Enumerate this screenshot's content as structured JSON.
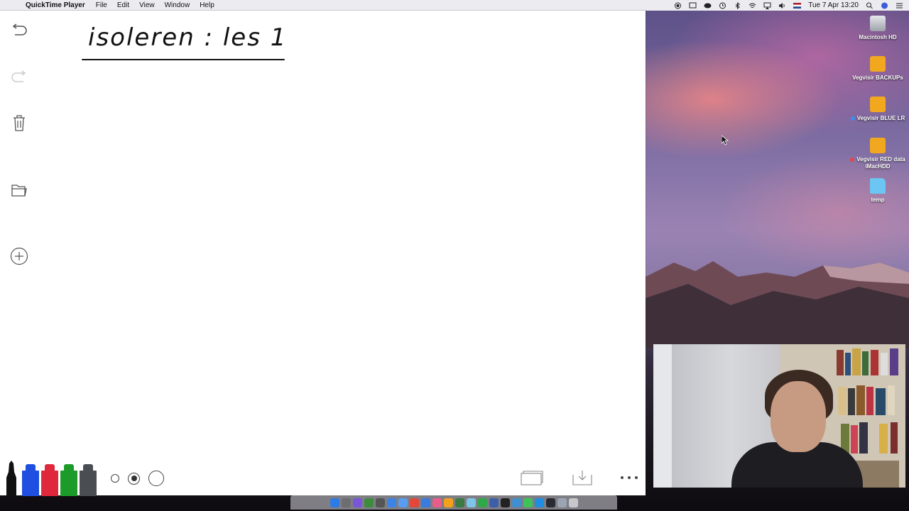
{
  "menubar": {
    "app_name": "QuickTime Player",
    "menus": [
      "File",
      "Edit",
      "View",
      "Window",
      "Help"
    ],
    "clock": "Tue 7 Apr  13:20"
  },
  "whiteboard": {
    "title": "isoleren : les 1",
    "marker_colors": [
      "#111111",
      "#1f4fe0",
      "#e0283c",
      "#1d9b2a",
      "#4a4d52"
    ],
    "pen_sizes": [
      "small",
      "medium",
      "large"
    ],
    "selected_pen_size": "medium"
  },
  "desktop_icons": [
    {
      "label": "Macintosh HD",
      "icon": "hard-drive-icon",
      "color": "#b8bcc4"
    },
    {
      "label": "Vegvisir BACKUPs",
      "icon": "external-drive-icon",
      "color": "#f1a81f"
    },
    {
      "label": "Vegvisir BLUE LR",
      "icon": "external-drive-icon",
      "color": "#f1a81f",
      "tag": "#3b8ff2"
    },
    {
      "label": "Vegvisir RED data iMacHDD",
      "icon": "external-drive-icon",
      "color": "#f1a81f",
      "tag": "#e5454a"
    },
    {
      "label": "temp",
      "icon": "folder-icon",
      "color": "#6cc6f3"
    }
  ],
  "dock_apps": [
    "#2d7ce5",
    "#6d6d72",
    "#7a57d9",
    "#3d8c3b",
    "#555",
    "#3b84e6",
    "#5a9cf0",
    "#e4463a",
    "#3a7be0",
    "#ec5c8a",
    "#f4a01c",
    "#3b7b43",
    "#7dc6e8",
    "#2fa84a",
    "#3c5fa8",
    "#222",
    "#3f8fd1",
    "#3dc35a",
    "#1f8de0",
    "#2a2a33",
    "#9aa4b2",
    "#c8c8cc"
  ]
}
